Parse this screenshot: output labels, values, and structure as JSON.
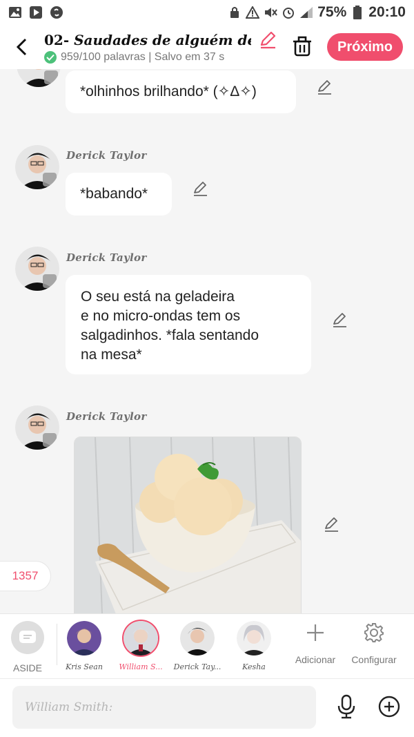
{
  "status_bar": {
    "battery": "75%",
    "time": "20:10",
    "icons": [
      "gallery-icon",
      "play-store-icon",
      "shazam-icon",
      "lock-sim-icon",
      "warning-icon",
      "mute-icon",
      "alarm-icon",
      "signal-icon",
      "battery-icon"
    ]
  },
  "header": {
    "title_prefix": "02- ",
    "title_italic": "Saudades de alguém desco...",
    "subtitle": "959/100 palavras | Salvo em 37 s",
    "next_label": "Próximo",
    "accent": "#f04e6d"
  },
  "messages": [
    {
      "type": "text",
      "author": "",
      "text": "*olhinhos brilhando* (✧Δ✧)"
    },
    {
      "type": "text",
      "author": "Derick Taylor",
      "text": "*babando*"
    },
    {
      "type": "text",
      "author": "Derick Taylor",
      "lines": [
        "O seu está na geladeira",
        "e no micro-ondas tem os",
        "salgadinhos. *fala sentando",
        "na mesa*"
      ]
    },
    {
      "type": "image",
      "author": "Derick Taylor",
      "image_desc": "ice-cream-bowl"
    }
  ],
  "count_badge": "1357",
  "char_bar": {
    "aside_label": "ASIDE",
    "characters": [
      {
        "name": "Kris Sean",
        "selected": false
      },
      {
        "name": "William S...",
        "selected": true
      },
      {
        "name": "Derick Tay...",
        "selected": false
      },
      {
        "name": "Kesha",
        "selected": false
      }
    ],
    "add_label": "Adicionar",
    "config_label": "Configurar"
  },
  "input": {
    "placeholder": "William Smith:"
  }
}
